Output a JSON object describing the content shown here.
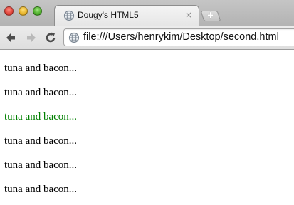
{
  "browser": {
    "tab": {
      "title": "Dougy's HTML5",
      "close_glyph": "×",
      "favicon": "globe-icon"
    },
    "new_tab_glyph": "+",
    "nav": {
      "back_icon": "back-arrow-icon",
      "forward_icon": "forward-arrow-icon",
      "reload_icon": "reload-icon"
    },
    "address_bar": {
      "icon": "globe-icon",
      "url": "file:///Users/henrykim/Desktop/second.html"
    }
  },
  "page": {
    "paragraphs": [
      {
        "text": "tuna and bacon...",
        "color": "#000000"
      },
      {
        "text": "tuna and bacon...",
        "color": "#000000"
      },
      {
        "text": "tuna and bacon...",
        "color": "#008000"
      },
      {
        "text": "tuna and bacon...",
        "color": "#000000"
      },
      {
        "text": "tuna and bacon...",
        "color": "#000000"
      },
      {
        "text": "tuna and bacon...",
        "color": "#000000"
      }
    ]
  }
}
